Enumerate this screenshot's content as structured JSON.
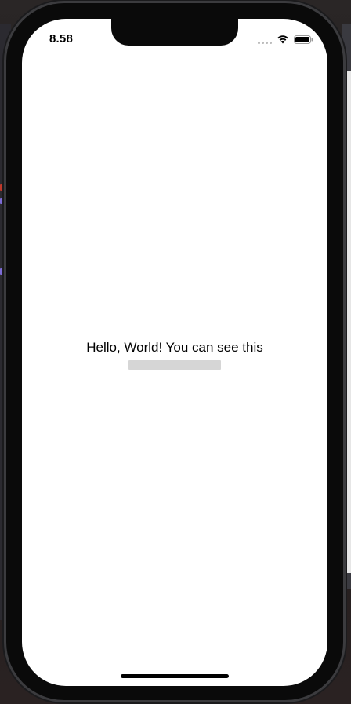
{
  "status_bar": {
    "time": "8.58",
    "icons": [
      "signal-icon",
      "wifi-icon",
      "battery-icon"
    ]
  },
  "content": {
    "message": "Hello, World! You can see this"
  },
  "colors": {
    "screen_background": "#ffffff",
    "text": "#000000",
    "redaction": "#d6d6d6",
    "device_frame": "#0a0a0a"
  }
}
